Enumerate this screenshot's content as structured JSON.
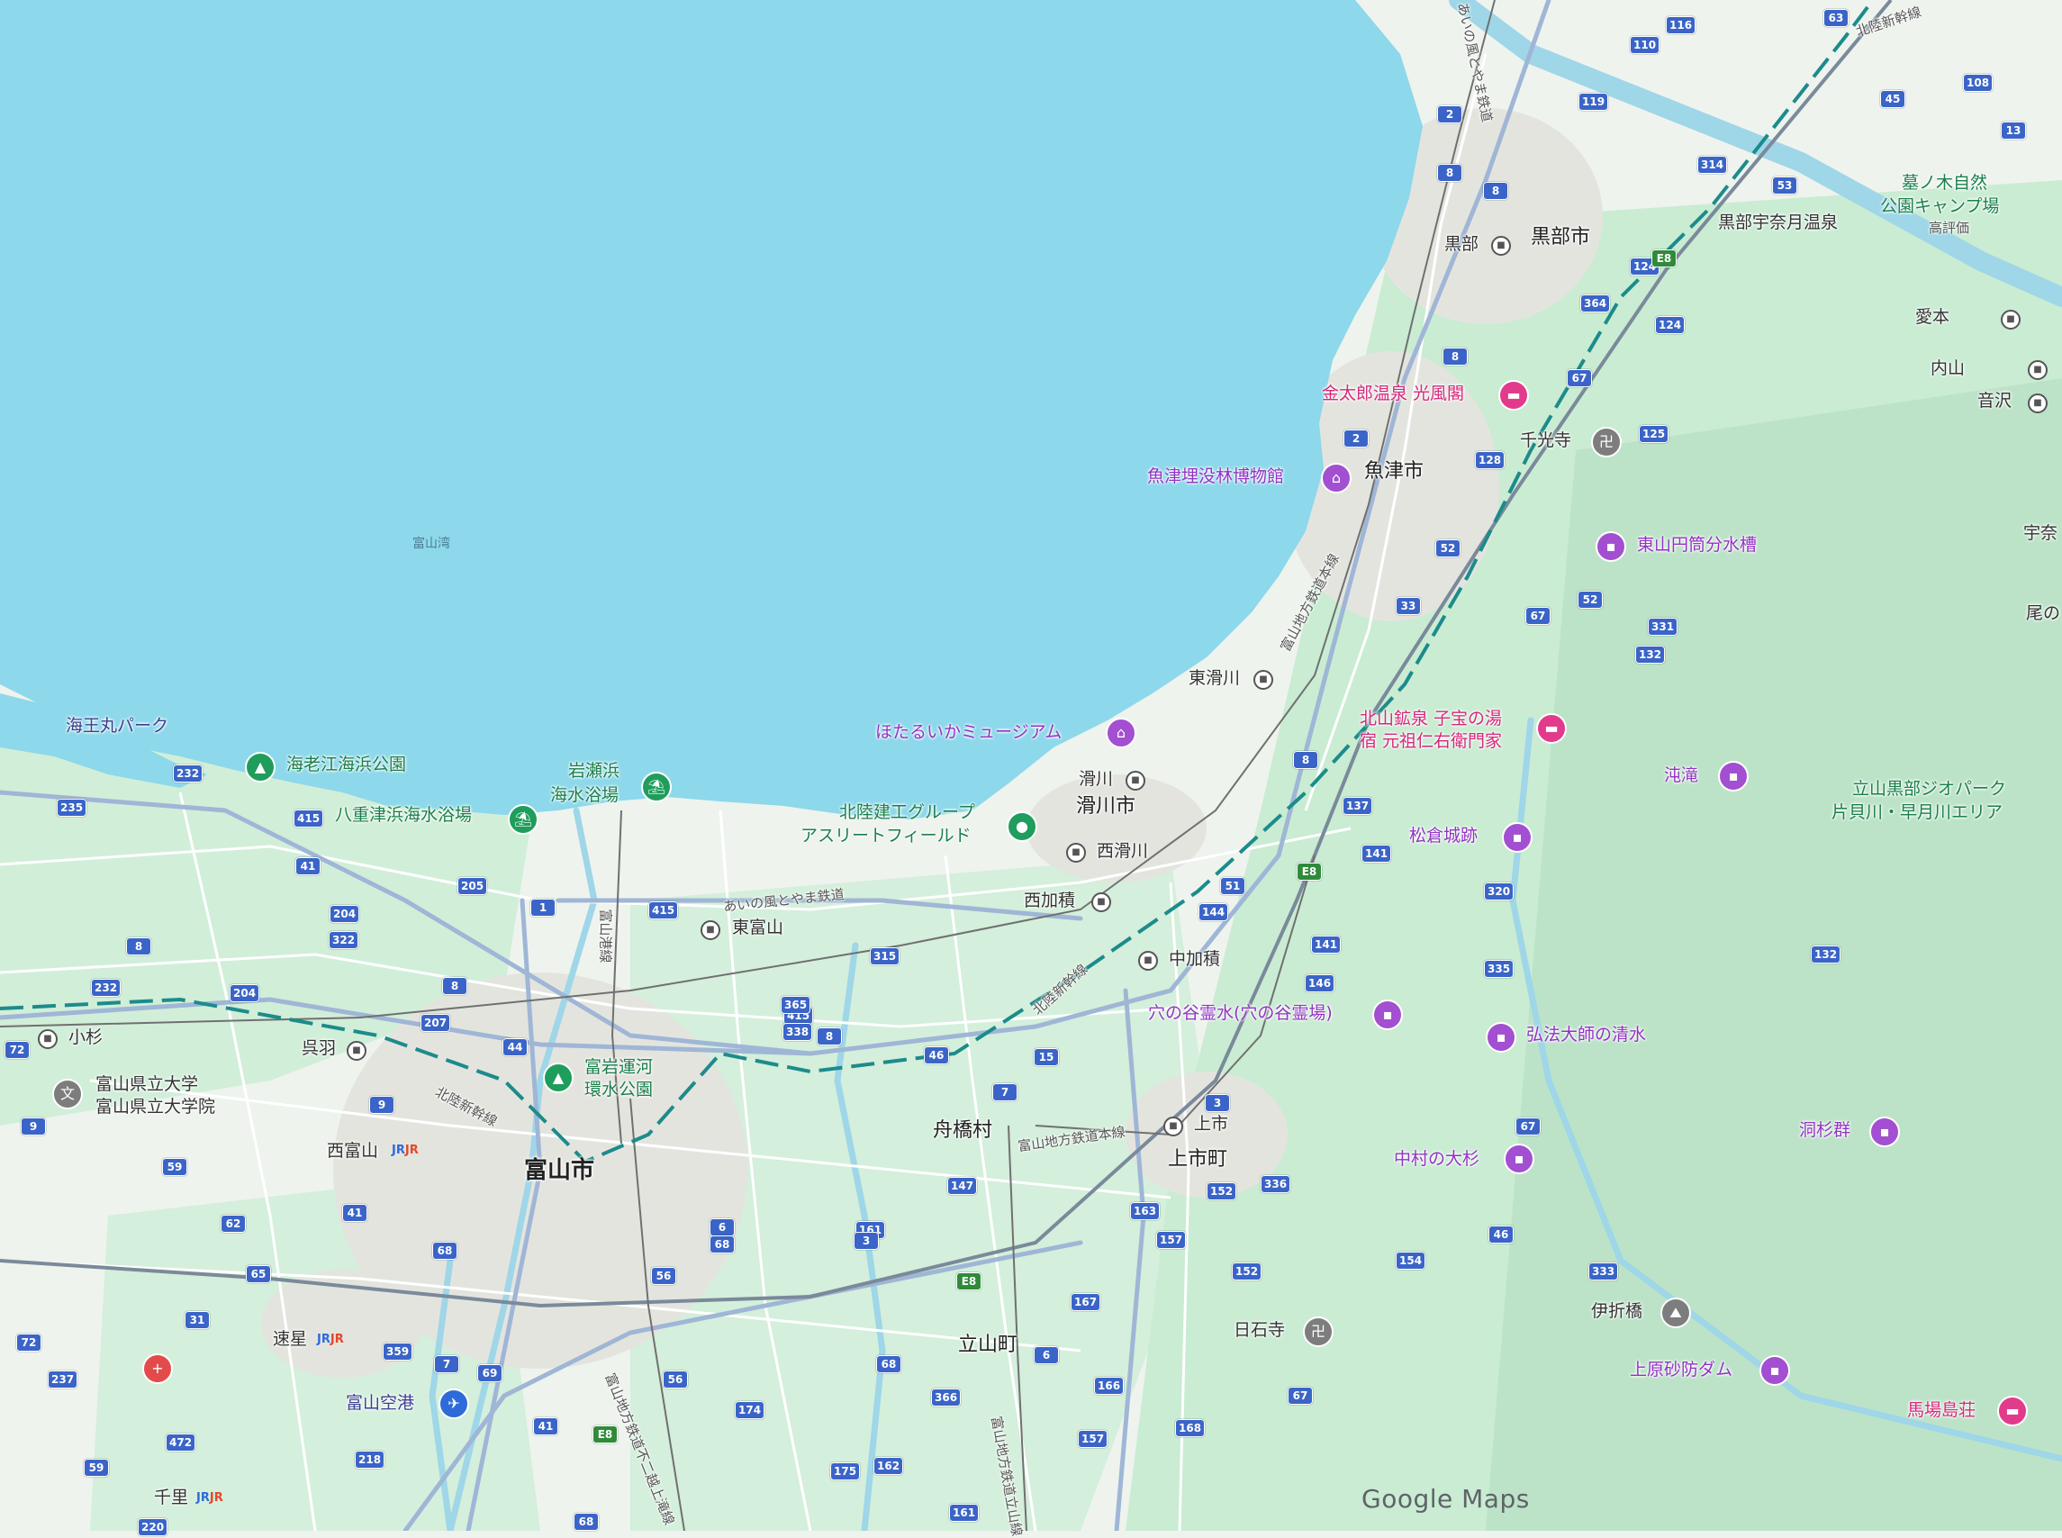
{
  "colors": {
    "sea": "#8dd8eb",
    "land": "#eef3ee",
    "green": "#c9ecd3",
    "urban": "#e6e6e1",
    "road": "#ffffff",
    "major_road": "#9fb6d6",
    "rail": "#7a7a7a",
    "shinkansen": "#1c8b8b"
  },
  "brand": "Google Maps",
  "sea_label": "富山湾",
  "cities": {
    "toyama": "富山市",
    "uozu": "魚津市",
    "kurobe_city": "黒部市",
    "namerikawa_city": "滑川市",
    "funahashi": "舟橋村",
    "tateyama": "立山町",
    "kamiichi_town": "上市町"
  },
  "stations": {
    "kurobe": "黒部",
    "higashi_namerikawa": "東滑川",
    "namerikawa": "滑川",
    "nishi_namerikawa": "西滑川",
    "nishi_kazumi": "西加積",
    "naka_kazumi": "中加積",
    "kamiichi": "上市",
    "higashi_toyama": "東富山",
    "kosugi": "小杉",
    "kureha": "呉羽",
    "nishi_toyama": "西富山",
    "hayahoshi": "速星",
    "senri": "千里",
    "aimoto": "愛本",
    "uchiyama": "内山",
    "otozawa": "音沢",
    "kurobe_unazuki": "黒部宇奈月温泉"
  },
  "pois": {
    "kaiomaru": "海王丸パーク",
    "ebie": "海老江海浜公園",
    "iwasehama_1": "岩瀬浜",
    "iwasehama_2": "海水浴場",
    "yatsue": "八重津浜海水浴場",
    "hotaruika": "ほたるいかミュージアム",
    "athlete_1": "北陸建工グループ",
    "athlete_2": "アスリートフィールド",
    "uozu_museum": "魚津埋没林博物館",
    "kintaro": "金太郎温泉 光風閣",
    "senkoji": "千光寺",
    "higashiyama": "東山円筒分水槽",
    "kitayama_1": "北山鉱泉 子宝の湯",
    "kitayama_2": "宿 元祖仁右衛門家",
    "matsukura": "松倉城跡",
    "bantaki": "沌滝",
    "anadani": "穴の谷霊水(穴の谷霊場)",
    "kobo": "弘法大師の清水",
    "nakamura": "中村の大杉",
    "dosugi": "洞杉群",
    "nisshakuji": "日石寺",
    "iorihashi": "伊折橋",
    "uehara": "上原砂防ダム",
    "babajima": "馬場島荘",
    "tomiiwa_1": "富岩運河",
    "tomiiwa_2": "環水公園",
    "pref_univ_1": "富山県立大学",
    "pref_univ_2": "富山県立大学院",
    "airport": "富山空港",
    "geopark_1": "立山黒部ジオパーク",
    "geopark_2": "片貝川・早月川エリア",
    "hakkonoki_1": "墓ノ木自然",
    "hakkonoki_2": "公園キャンプ場",
    "hakkonoki_3": "高評価",
    "right_1": "宇奈",
    "right_2": "尾の"
  },
  "rail_lines": {
    "ainokaze": "あいの風とやま鉄道",
    "chitetsu_main": "富山地方鉄道本線",
    "shinkansen": "北陸新幹線",
    "chitetsu_honsen2": "富山地方鉄道本線",
    "chitetsu_fujikoshi": "富山地方鉄道不二越上滝線",
    "chitetsu_tateyama": "富山地方鉄道立山線",
    "ainokaze_north": "あいの風とやま鉄道",
    "shinkansen_ne": "北陸新幹線",
    "tomiiwa_line": "富山港線"
  },
  "routes": [
    "116",
    "110",
    "63",
    "108",
    "119",
    "45",
    "13",
    "314",
    "53",
    "8",
    "124",
    "364",
    "E8",
    "124",
    "67",
    "2",
    "128",
    "125",
    "52",
    "33",
    "67",
    "52",
    "331",
    "132",
    "8",
    "137",
    "141",
    "320",
    "51",
    "144",
    "141",
    "335",
    "132",
    "146",
    "3",
    "67",
    "152",
    "163",
    "336",
    "157",
    "152",
    "154",
    "46",
    "333",
    "167",
    "6",
    "166",
    "67",
    "168",
    "157",
    "232",
    "235",
    "415",
    "41",
    "205",
    "1",
    "415",
    "204",
    "322",
    "315",
    "8",
    "232",
    "204",
    "8",
    "207",
    "415",
    "365",
    "338",
    "8",
    "46",
    "15",
    "7",
    "44",
    "9",
    "9",
    "59",
    "41",
    "62",
    "68",
    "65",
    "56",
    "6",
    "68",
    "161",
    "147",
    "3",
    "E8",
    "31",
    "72",
    "237",
    "359",
    "7",
    "69",
    "41",
    "E8",
    "56",
    "174",
    "68",
    "366",
    "472",
    "218",
    "175",
    "162",
    "59",
    "220",
    "161",
    "68",
    "72",
    "2",
    "8",
    "8",
    "E8"
  ]
}
